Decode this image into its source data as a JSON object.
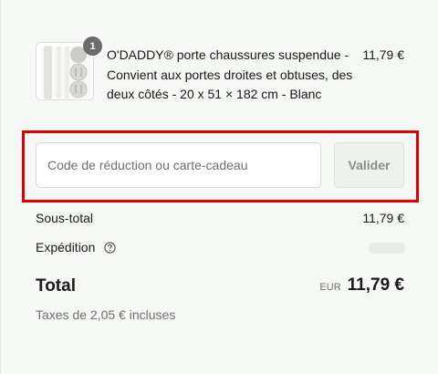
{
  "order_summary": {
    "product": {
      "title": "O'DADDY® porte chaussures suspendue - Convient aux portes droites et obtuses, des deux côtés - 20 x 51 × 182 cm - Blanc",
      "price": "11,79 €",
      "quantity": "1",
      "image_icon": "shoe-organizer-product-image"
    },
    "discount": {
      "placeholder": "Code de réduction ou carte-cadeau",
      "value": "",
      "apply_label": "Valider"
    },
    "subtotal": {
      "label": "Sous-total",
      "value": "11,79 €"
    },
    "shipping": {
      "label": "Expédition",
      "help_icon": "help-circle-icon",
      "value": ""
    },
    "total": {
      "label": "Total",
      "currency": "EUR",
      "value": "11,79 €"
    },
    "taxes_note": "Taxes de 2,05 € incluses"
  },
  "colors": {
    "background": "#f5f8f4",
    "highlight": "#e00000",
    "badge": "#6b6b6b",
    "muted_text": "#707070"
  }
}
